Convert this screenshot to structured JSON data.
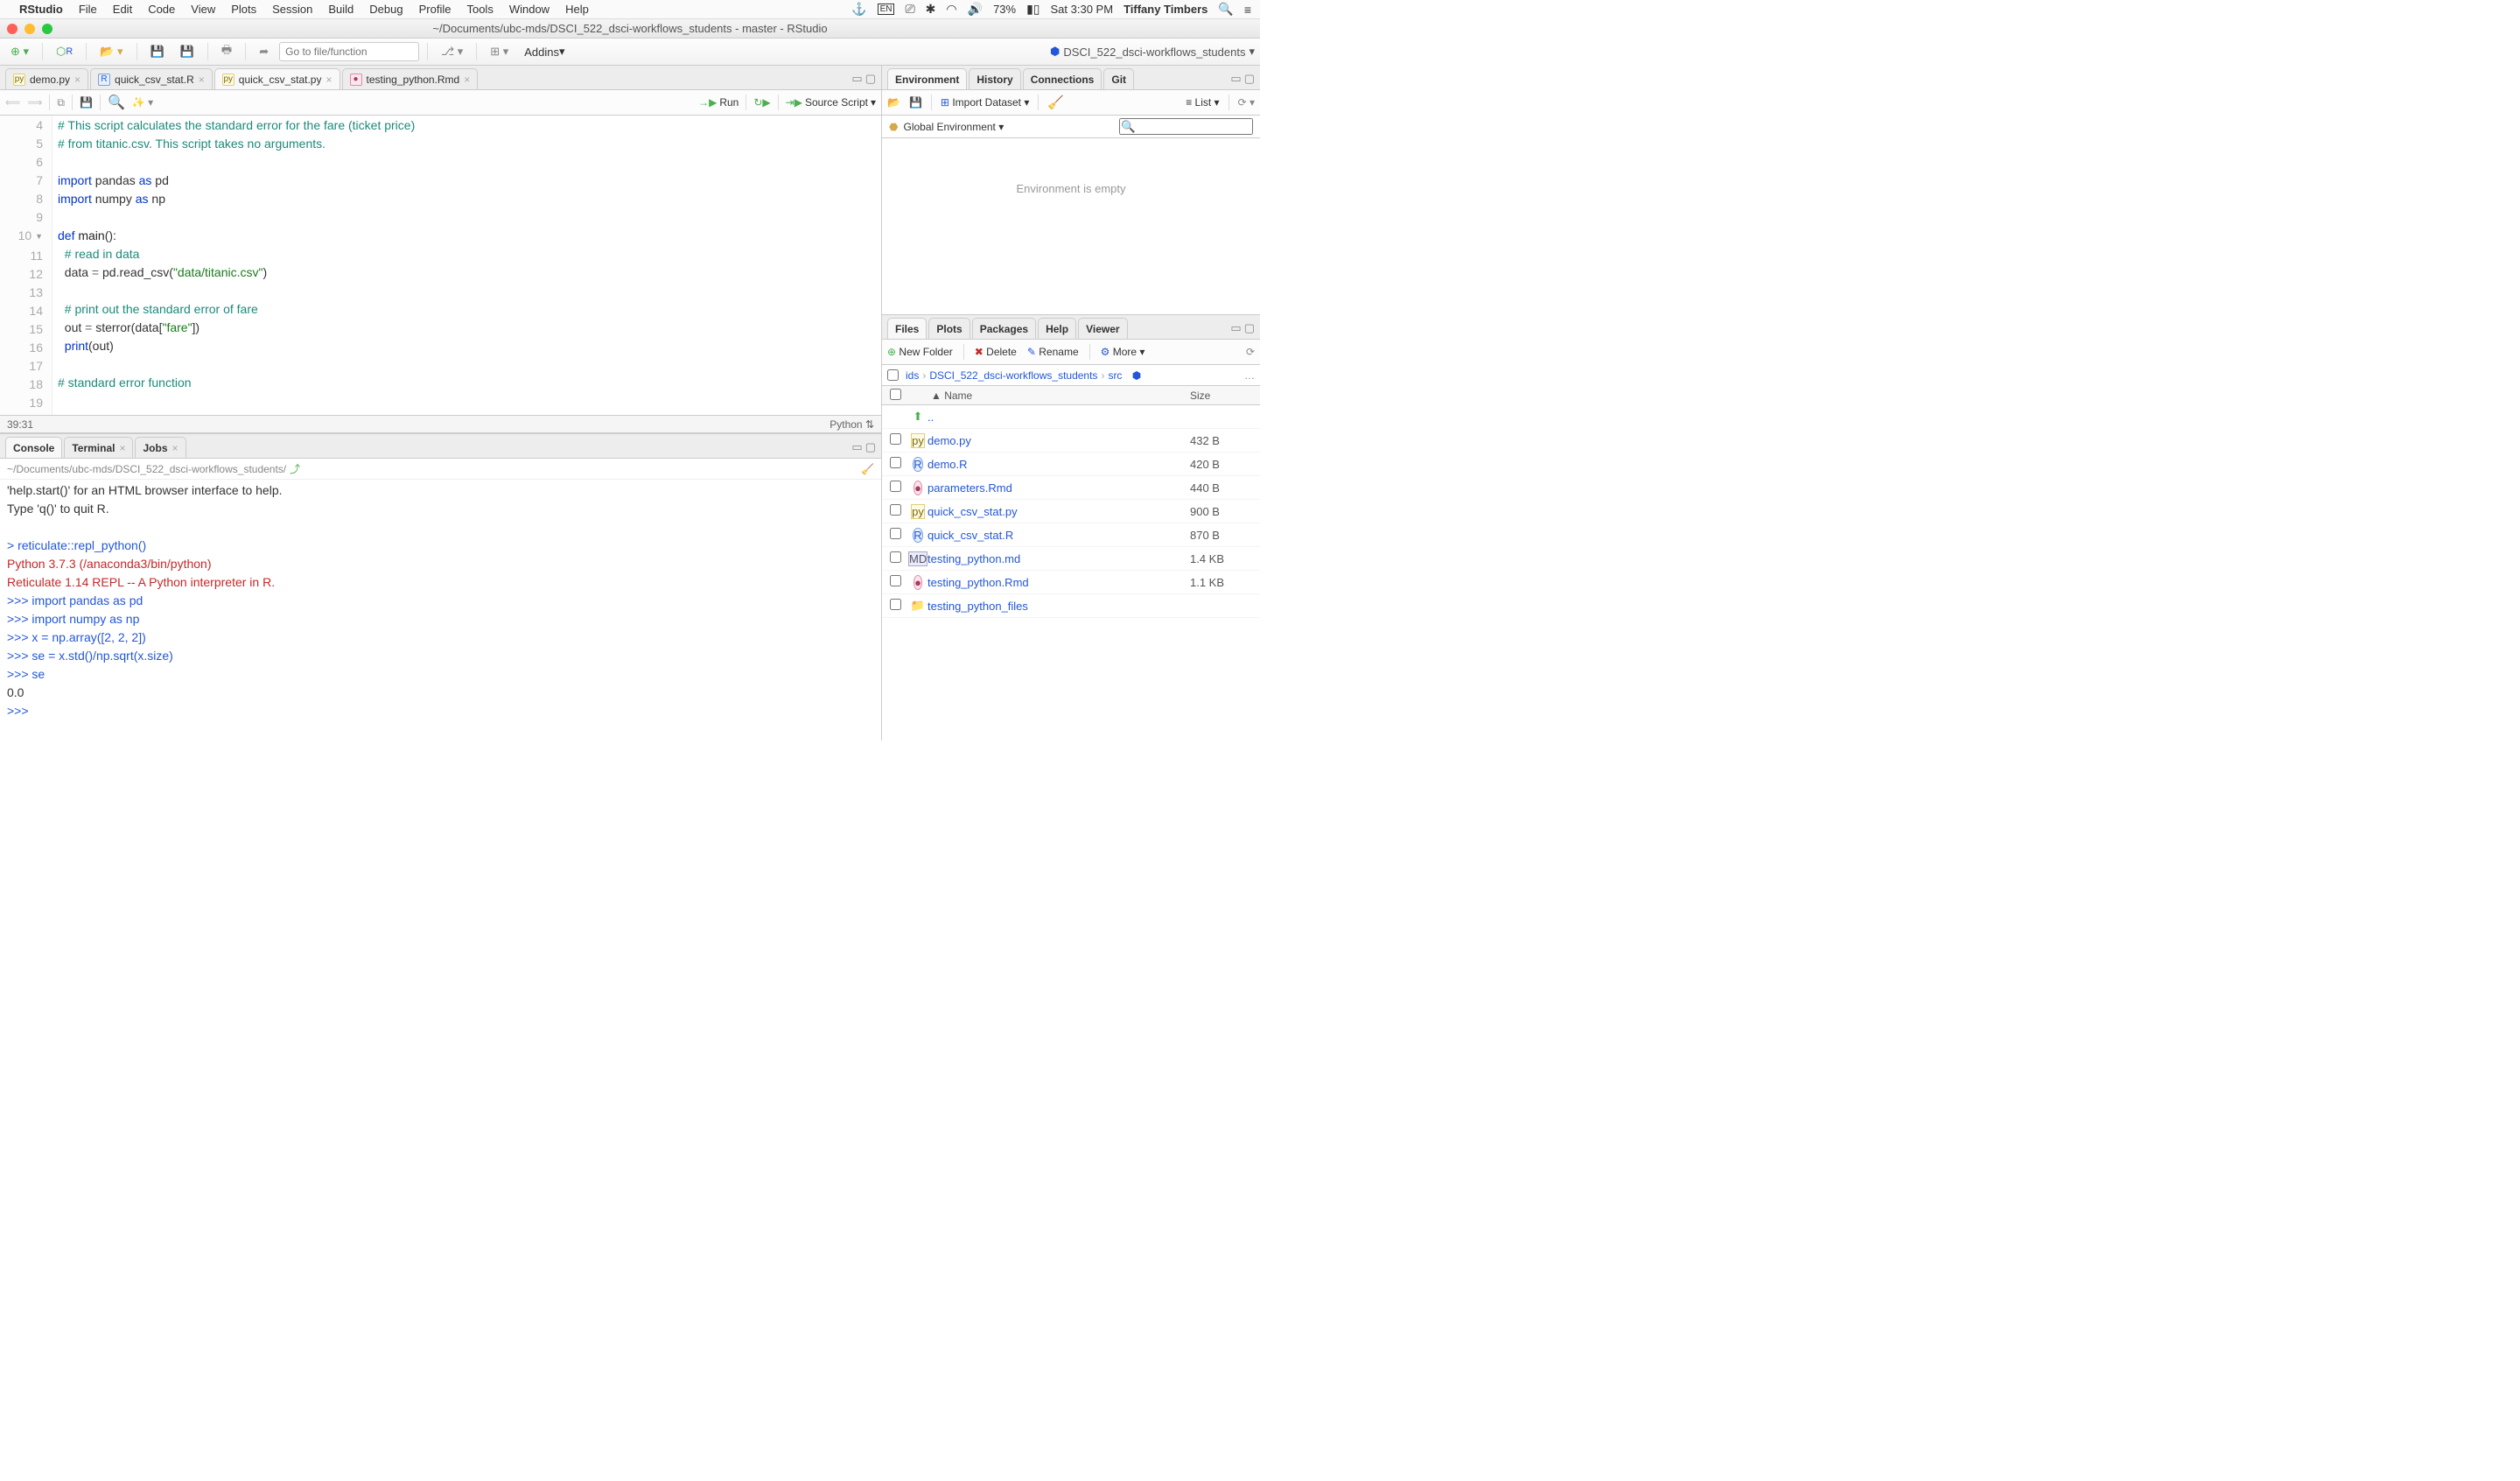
{
  "menubar": {
    "app": "RStudio",
    "items": [
      "File",
      "Edit",
      "Code",
      "View",
      "Plots",
      "Session",
      "Build",
      "Debug",
      "Profile",
      "Tools",
      "Window",
      "Help"
    ],
    "battery": "73%",
    "clock": "Sat 3:30 PM",
    "user": "Tiffany Timbers"
  },
  "window": {
    "title": "~/Documents/ubc-mds/DSCI_522_dsci-workflows_students - master - RStudio"
  },
  "toolbar": {
    "search_placeholder": "Go to file/function",
    "addins": "Addins",
    "project": "DSCI_522_dsci-workflows_students"
  },
  "source": {
    "tabs": [
      {
        "name": "demo.py",
        "type": "py",
        "active": false
      },
      {
        "name": "quick_csv_stat.R",
        "type": "r",
        "active": false
      },
      {
        "name": "quick_csv_stat.py",
        "type": "py",
        "active": true
      },
      {
        "name": "testing_python.Rmd",
        "type": "rmd",
        "active": false
      }
    ],
    "toolbar": {
      "run": "Run",
      "source": "Source Script"
    },
    "gutter_start": 4,
    "lines": [
      {
        "n": 4,
        "html": "<span class='com'># This script calculates the standard error for the fare (ticket price)</span>"
      },
      {
        "n": 5,
        "html": "<span class='com'># from titanic.csv. This script takes no arguments.</span>"
      },
      {
        "n": 6,
        "html": ""
      },
      {
        "n": 7,
        "html": "<span class='kw'>import</span> pandas <span class='kw'>as</span> pd"
      },
      {
        "n": 8,
        "html": "<span class='kw'>import</span> numpy <span class='kw'>as</span> np"
      },
      {
        "n": 9,
        "html": ""
      },
      {
        "n": 10,
        "fold": true,
        "html": "<span class='kw'>def</span> <span class='fn'>main</span>():"
      },
      {
        "n": 11,
        "html": "  <span class='com'># read in data</span>"
      },
      {
        "n": 12,
        "html": "  data <span class='op'>=</span> pd.read_csv(<span class='str'>\"data/titanic.csv\"</span>)"
      },
      {
        "n": 13,
        "html": ""
      },
      {
        "n": 14,
        "html": "  <span class='com'># print out the standard error of fare</span>"
      },
      {
        "n": 15,
        "html": "  out <span class='op'>=</span> sterror(data[<span class='str'>\"fare\"</span>])"
      },
      {
        "n": 16,
        "html": "  <span class='kw'>print</span>(out)"
      },
      {
        "n": 17,
        "html": ""
      },
      {
        "n": 18,
        "html": "<span class='com'># standard error function</span>"
      },
      {
        "n": 19,
        "html": ""
      }
    ],
    "status": {
      "pos": "39:31",
      "lang": "Python"
    }
  },
  "bottom_tabs": [
    "Console",
    "Terminal",
    "Jobs"
  ],
  "console": {
    "path": "~/Documents/ubc-mds/DSCI_522_dsci-workflows_students/",
    "lines": [
      {
        "cls": "",
        "txt": "'help.start()' for an HTML browser interface to help."
      },
      {
        "cls": "",
        "txt": "Type 'q()' to quit R."
      },
      {
        "cls": "",
        "txt": ""
      },
      {
        "cls": "blue",
        "txt": "> reticulate::repl_python()"
      },
      {
        "cls": "redtxt",
        "txt": "Python 3.7.3 (/anaconda3/bin/python)"
      },
      {
        "cls": "redtxt",
        "txt": "Reticulate 1.14 REPL -- A Python interpreter in R."
      },
      {
        "cls": "blue",
        "txt": ">>> import pandas as pd"
      },
      {
        "cls": "blue",
        "txt": ">>> import numpy as np"
      },
      {
        "cls": "blue",
        "txt": ">>> x = np.array([2, 2, 2])"
      },
      {
        "cls": "blue",
        "txt": ">>> se = x.std()/np.sqrt(x.size)"
      },
      {
        "cls": "blue",
        "txt": ">>> se"
      },
      {
        "cls": "",
        "txt": "0.0"
      },
      {
        "cls": "blue",
        "txt": ">>> "
      }
    ]
  },
  "env": {
    "tabs": [
      "Environment",
      "History",
      "Connections",
      "Git"
    ],
    "import": "Import Dataset",
    "list": "List",
    "scope": "Global Environment",
    "empty": "Environment is empty"
  },
  "files": {
    "tabs": [
      "Files",
      "Plots",
      "Packages",
      "Help",
      "Viewer"
    ],
    "toolbar": {
      "new": "New Folder",
      "delete": "Delete",
      "rename": "Rename",
      "more": "More"
    },
    "breadcrumb": [
      "ids",
      "DSCI_522_dsci-workflows_students",
      "src"
    ],
    "header": {
      "name": "Name",
      "size": "Size"
    },
    "up": "..",
    "rows": [
      {
        "icon": "py",
        "name": "demo.py",
        "size": "432 B"
      },
      {
        "icon": "r",
        "name": "demo.R",
        "size": "420 B"
      },
      {
        "icon": "rmd",
        "name": "parameters.Rmd",
        "size": "440 B"
      },
      {
        "icon": "py",
        "name": "quick_csv_stat.py",
        "size": "900 B"
      },
      {
        "icon": "r",
        "name": "quick_csv_stat.R",
        "size": "870 B"
      },
      {
        "icon": "md",
        "name": "testing_python.md",
        "size": "1.4 KB"
      },
      {
        "icon": "rmd",
        "name": "testing_python.Rmd",
        "size": "1.1 KB"
      },
      {
        "icon": "folder",
        "name": "testing_python_files",
        "size": ""
      }
    ]
  }
}
